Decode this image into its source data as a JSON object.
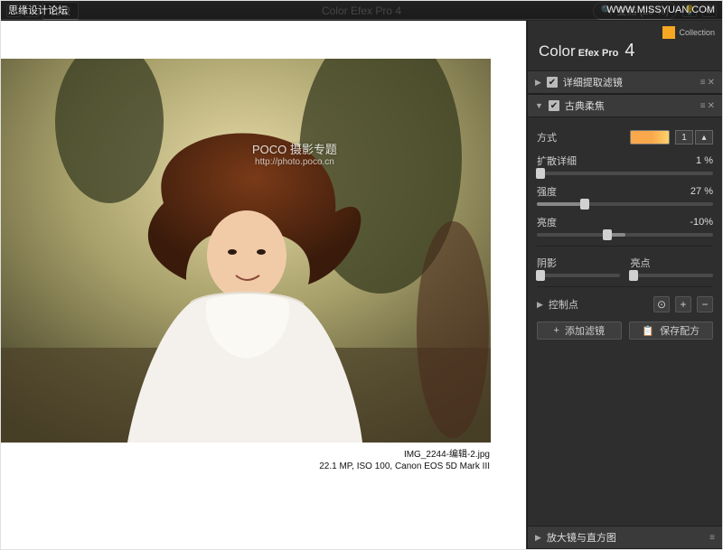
{
  "watermark": {
    "left": "思缘设计论坛",
    "right": "WWW.MISSYUAN.COM"
  },
  "topbar": {
    "compare_label": "比较",
    "title": "Color Efex Pro 4",
    "zoom_label": "变焦 (25 %)"
  },
  "canvas": {
    "filename": "IMG_2244-编辑-2.jpg",
    "meta": "22.1 MP, ISO 100, Canon EOS 5D Mark III",
    "poco_wm_main": "POCO 摄影专题",
    "poco_wm_sub": "http://photo.poco.cn"
  },
  "panel": {
    "nik_label": "Collection",
    "brand_light": "Color",
    "brand_heavy": "Efex Pro",
    "brand_num": "4",
    "sec1_title": "详细提取滤镜",
    "sec2_title": "古典柔焦",
    "method_label": "方式",
    "method_value": "1",
    "diffuse_label": "扩散详细",
    "diffuse_value": "1 %",
    "strength_label": "强度",
    "strength_value": "27 %",
    "bright_label": "亮度",
    "bright_value": "-10%",
    "shadow_label": "阴影",
    "highlight_label": "亮点",
    "ctrlpoints_label": "控制点",
    "add_filter_label": "添加滤镜",
    "save_recipe_label": "保存配方",
    "zoomhist_label": "放大镜与直方图"
  }
}
